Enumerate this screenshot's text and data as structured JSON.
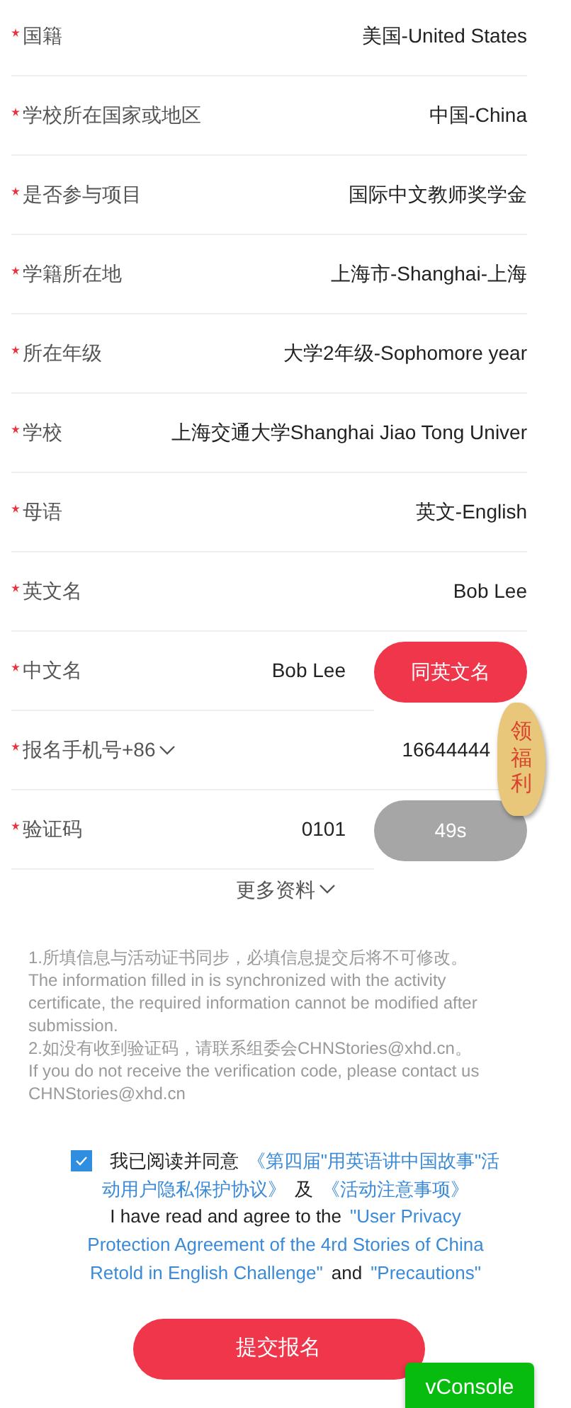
{
  "fields": [
    {
      "kind": "select",
      "label": "国籍",
      "required": true,
      "value": "美国-United States"
    },
    {
      "kind": "select",
      "label": "学校所在国家或地区",
      "required": true,
      "value": "中国-China"
    },
    {
      "kind": "select",
      "label": "是否参与项目",
      "required": true,
      "value": "国际中文教师奖学金"
    },
    {
      "kind": "select",
      "label": "学籍所在地",
      "required": true,
      "value": "上海市-Shanghai-上海"
    },
    {
      "kind": "select",
      "label": "所在年级",
      "required": true,
      "value": "大学2年级-Sophomore year"
    },
    {
      "kind": "select",
      "label": "学校",
      "required": true,
      "value": "上海交通大学Shanghai Jiao Tong Univer"
    },
    {
      "kind": "select",
      "label": "母语",
      "required": true,
      "value": "英文-English"
    },
    {
      "kind": "input",
      "label": "英文名",
      "required": true,
      "value": "Bob Lee"
    },
    {
      "kind": "input_button",
      "label": "中文名",
      "required": true,
      "value": "Bob Lee",
      "button": {
        "label": "同英文名",
        "disabled": false
      }
    },
    {
      "kind": "phone",
      "label": "报名手机号+86",
      "required": true,
      "value": "16644444"
    },
    {
      "kind": "input_button",
      "label": "验证码",
      "required": true,
      "value": "0101",
      "button": {
        "label": "49s",
        "disabled": true
      }
    }
  ],
  "more_link": "更多资料",
  "notes": [
    "1.所填信息与活动证书同步，必填信息提交后将不可修改。",
    "The information filled in is synchronized with the activity certificate, the required information cannot be modified after submission.",
    "2.如没有收到验证码，请联系组委会CHNStories@xhd.cn。",
    "If you do not receive the verification code, please contact us CHNStories@xhd.cn"
  ],
  "agreement": {
    "checked": true,
    "lines": [
      [
        {
          "kind": "text",
          "text": "我已阅读并同意"
        },
        {
          "kind": "link",
          "text": "《第四届\"用英语讲中国故事\"活"
        }
      ],
      [
        {
          "kind": "link",
          "text": "动用户隐私保护协议》"
        },
        {
          "kind": "text",
          "text": "及"
        },
        {
          "kind": "link",
          "text": "《活动注意事项》"
        }
      ],
      [
        {
          "kind": "text",
          "text": "I have read and agree to the"
        },
        {
          "kind": "link",
          "text": "\"User Privacy"
        }
      ],
      [
        {
          "kind": "link",
          "text": "Protection Agreement of the 4rd Stories of China"
        }
      ],
      [
        {
          "kind": "link",
          "text": "Retold in English Challenge\""
        },
        {
          "kind": "text",
          "text": "and"
        },
        {
          "kind": "link",
          "text": "\"Precautions\""
        }
      ]
    ]
  },
  "submit_button": "提交报名",
  "bonus_badge": "领福利",
  "vconsole_button": "vConsole"
}
